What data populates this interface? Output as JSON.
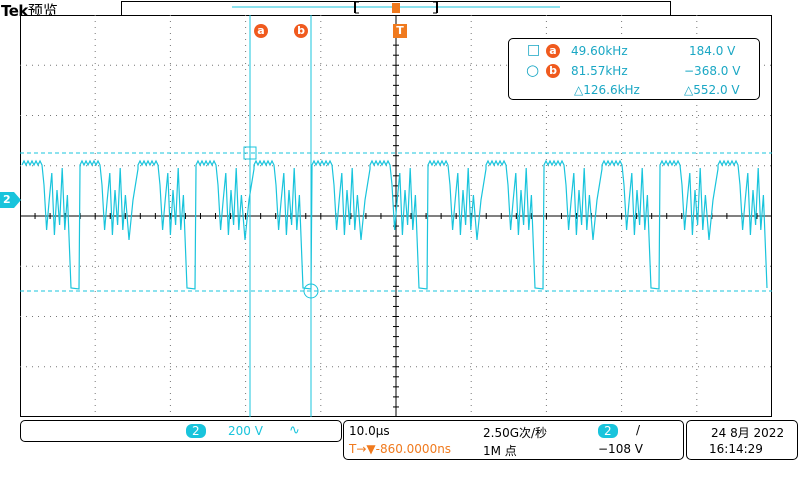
{
  "header": {
    "brand": "Tek",
    "mode": "预览"
  },
  "cursors": {
    "a_label": "a",
    "b_label": "b",
    "trigger_label": "T"
  },
  "channel_marker": "2",
  "readout": {
    "row_a": {
      "symbol": "□",
      "label": "a",
      "freq": "49.60kHz",
      "volt": "184.0 V"
    },
    "row_b": {
      "symbol": "○",
      "label": "b",
      "freq": "81.57kHz",
      "volt": "−368.0 V"
    },
    "delta": {
      "freq": "△126.6kHz",
      "volt": "△552.0 V"
    }
  },
  "vertical": {
    "channel": "2",
    "scale": "200 V",
    "coupling": "∿"
  },
  "horizontal": {
    "timebase": "10.0µs",
    "sample_rate": "2.50G次/秒",
    "position": "T→▼-860.0000ns",
    "record_length": "1M 点"
  },
  "trigger": {
    "channel": "2",
    "slope": "/",
    "level": "−108 V"
  },
  "datetime": {
    "date": "24 8月 2022",
    "time": "16:14:29"
  },
  "colors": {
    "trace": "#19c4dc",
    "cursor_chip": "#f05a1e",
    "trigger": "#f07a1e",
    "grid": "#555555"
  }
}
